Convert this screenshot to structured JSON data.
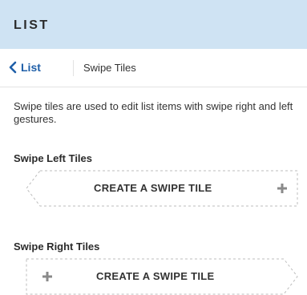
{
  "header": {
    "title": "LIST"
  },
  "nav": {
    "back_label": "List",
    "current": "Swipe Tiles"
  },
  "description": "Swipe tiles are used to edit list items with swipe right and left gestures.",
  "swipe_left": {
    "title": "Swipe Left Tiles",
    "tile_label": "CREATE A SWIPE TILE"
  },
  "swipe_right": {
    "title": "Swipe Right Tiles",
    "tile_label": "CREATE A SWIPE TILE"
  },
  "colors": {
    "header_bg": "#cfe3f3",
    "link": "#1f5fa8",
    "tile_border": "#bdbdbd",
    "plus": "#8a8a8a"
  },
  "icons": {
    "back": "chevron-left-icon",
    "add": "plus-icon"
  }
}
